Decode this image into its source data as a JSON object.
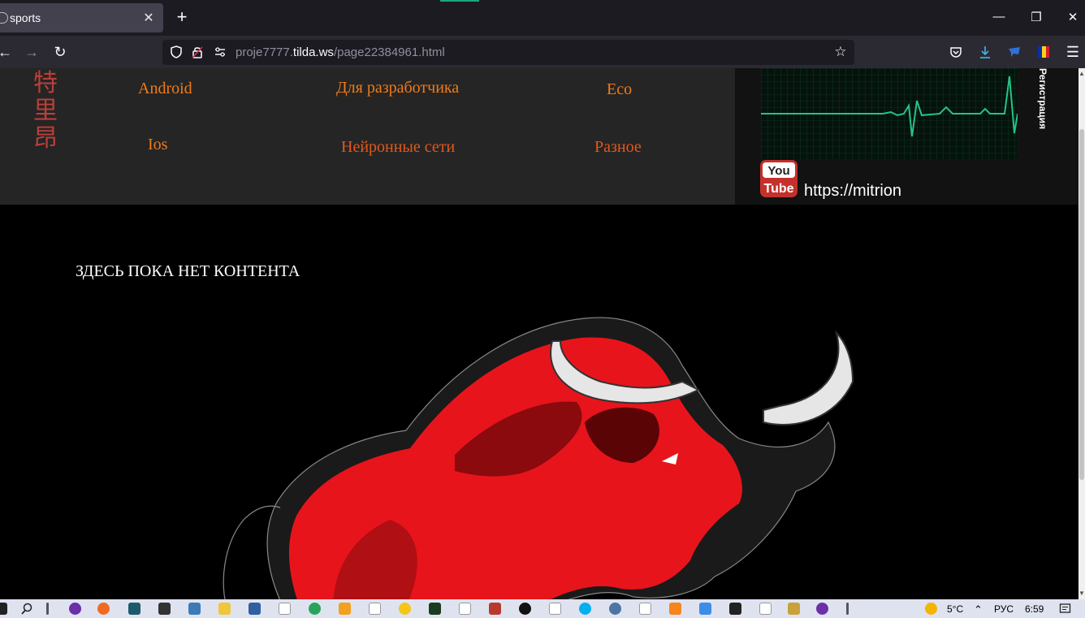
{
  "browser": {
    "tab_title": "sports",
    "tab_close": "✕",
    "new_tab": "+",
    "url_prefix": "proje7777.",
    "url_domain": "tilda.ws",
    "url_path": "/page22384961.html"
  },
  "window_controls": {
    "minimize": "—",
    "restore": "❐",
    "close": "✕"
  },
  "site": {
    "logo_glyphs": [
      "特",
      "里",
      "昂"
    ],
    "menu": {
      "android": "Android",
      "developer": "Для разработчика",
      "eco": "Eco",
      "ios": "Ios",
      "neural": "Нейронные сети",
      "misc": "Разное"
    },
    "registration_vertical": "Регистрация",
    "youtube_logo_top": "You",
    "youtube_logo_bottom": "Tube",
    "youtube_url": "https://mitrion",
    "notice": "ЗДЕСЬ ПОКА НЕТ КОНТЕНТА"
  },
  "taskbar": {
    "weather": "5°C",
    "lang": "РУС",
    "time": "6:59"
  },
  "colors": {
    "menu_orange": "#f07b18",
    "menu_red": "#e2581a",
    "logo_red": "#b9403a",
    "bull_red": "#e8141b"
  }
}
